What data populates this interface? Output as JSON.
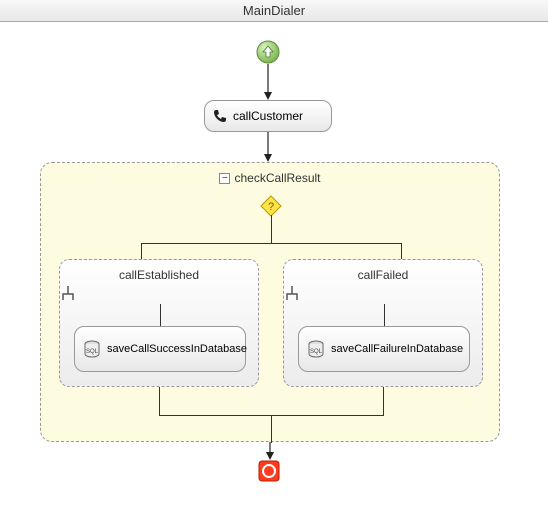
{
  "title": "MainDialer",
  "action": {
    "label": "callCustomer"
  },
  "container": {
    "label": "checkCallResult",
    "branches": {
      "left": {
        "label": "callEstablished",
        "inner": "saveCallSuccessInDatabase"
      },
      "right": {
        "label": "callFailed",
        "inner": "saveCallFailureInDatabase"
      }
    }
  }
}
